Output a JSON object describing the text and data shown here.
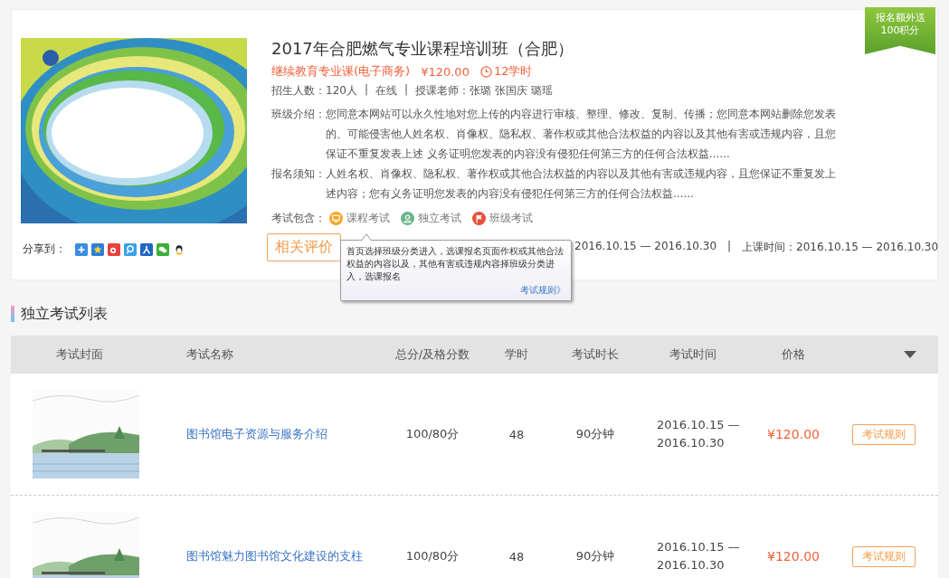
{
  "badge": {
    "lines": [
      "报名额外送",
      "100积分"
    ]
  },
  "course": {
    "title": "2017年合肥燃气专业课程培训班（合肥）",
    "category": "继续教育专业课(电子商务)",
    "price": "¥120.00",
    "hours": "12学时",
    "meta": [
      "招生人数：120人",
      "|",
      "在线",
      "|",
      "授课老师：张璐  张国庆  璐瑶"
    ],
    "intro": {
      "label": "班级介绍：",
      "text": "您同意本网站可以永久性地对您上传的内容进行审核、整理、修改、复制、传播；您同意本网站删除您发表的、可能侵害他人姓名权、肖像权、隐私权、著作权或其他合法权益的内容以及其他有害或违规内容，且您保证不重复发表上述 义务证明您发表的内容没有侵犯任何第三方的任何合法权益......"
    },
    "notice": {
      "label": "报名须知：",
      "text": "人姓名权、肖像权、隐私权、著作权或其他合法权益的内容以及其他有害或违规内容，且您保证不重复发上述内容；您有义务证明您发表的内容没有侵犯任何第三方的任何合法权益......"
    },
    "exams_included": {
      "label": "考试包含：",
      "items": [
        {
          "kind": "course",
          "label": "课程考试"
        },
        {
          "kind": "independent",
          "label": "独立考试"
        },
        {
          "kind": "class",
          "label": "班级考试"
        }
      ]
    },
    "share_label": "分享到：",
    "review_button": "相关评价",
    "schedule": [
      "2016.10.15 — 2016.10.30",
      "|",
      "上课时间：2016.10.15 — 2016.10.30"
    ],
    "tooltip": {
      "text": "首页选择班级分类进入，选课报名页面作权或其他合法权益的内容以及，其他有害或违规内容择班级分类进入，选课报名",
      "link": "考试规则》"
    }
  },
  "section_title": "独立考试列表",
  "table": {
    "columns": [
      "考试封面",
      "考试名称",
      "总分/及格分数",
      "学时",
      "考试时长",
      "考试时间",
      "价格"
    ],
    "rows": [
      {
        "name": "图书馆电子资源与服务介绍",
        "score": "100/80分",
        "hours": "48",
        "duration": "90分钟",
        "time": "2016.10.15 — 2016.10.30",
        "price": "¥120.00",
        "action": "考试规则"
      },
      {
        "name": "图书馆魅力图书馆文化建设的支柱",
        "score": "100/80分",
        "hours": "48",
        "duration": "90分钟",
        "time": "2016.10.15 — 2016.10.30",
        "price": "¥120.00",
        "action": "考试规则"
      }
    ]
  }
}
